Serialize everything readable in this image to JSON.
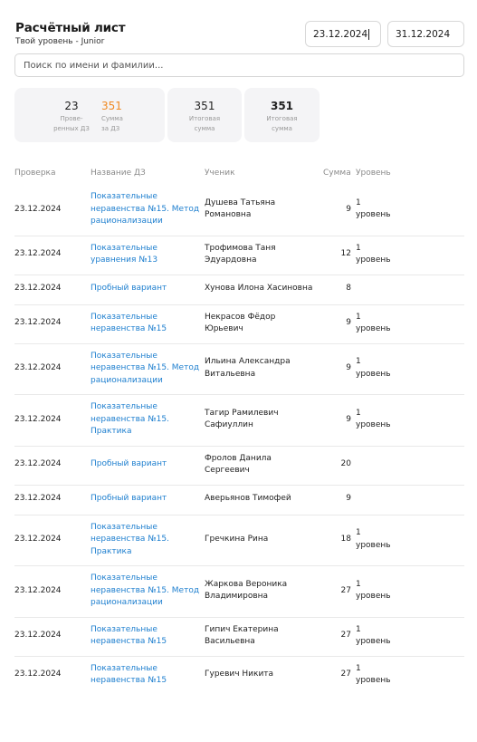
{
  "header": {
    "title": "Расчётный лист",
    "subtitle": "Твой уровень - Junior"
  },
  "dates": {
    "from": "23.12.2024",
    "to": "31.12.2024"
  },
  "search": {
    "placeholder": "Поиск по имени и фамилии..."
  },
  "stats": {
    "checked": {
      "value": "23",
      "label_1": "Прове-",
      "label_2": "ренных ДЗ"
    },
    "sum_hw": {
      "value": "351",
      "label_1": "Сумма",
      "label_2": "за ДЗ"
    },
    "total_1": {
      "value": "351",
      "label_1": "Итоговая",
      "label_2": "сумма"
    },
    "total_2": {
      "value": "351",
      "label_1": "Итоговая",
      "label_2": "сумма"
    }
  },
  "table": {
    "columns": [
      "Проверка",
      "Название ДЗ",
      "Ученик",
      "Сумма",
      "Уровень"
    ],
    "rows": [
      {
        "date": "23.12.2024",
        "hw": [
          "Показательные",
          "неравенства №15. Метод",
          "рационализации"
        ],
        "student": [
          "Душева Татьяна",
          "Романовна"
        ],
        "sum": "9",
        "level": [
          "1",
          "уровень"
        ]
      },
      {
        "date": "23.12.2024",
        "hw": [
          "Показательные",
          "уравнения №13"
        ],
        "student": [
          "Трофимова Таня",
          "Эдуардовна"
        ],
        "sum": "12",
        "level": [
          "1",
          "уровень"
        ]
      },
      {
        "date": "23.12.2024",
        "hw": [
          "Пробный вариант"
        ],
        "student": [
          "Хунова Илона Хасиновна"
        ],
        "sum": "8",
        "level": []
      },
      {
        "date": "23.12.2024",
        "hw": [
          "Показательные",
          "неравенства №15"
        ],
        "student": [
          "Некрасов Фёдор",
          "Юрьевич"
        ],
        "sum": "9",
        "level": [
          "1",
          "уровень"
        ]
      },
      {
        "date": "23.12.2024",
        "hw": [
          "Показательные",
          "неравенства №15. Метод",
          "рационализации"
        ],
        "student": [
          "Ильина Александра",
          "Витальевна"
        ],
        "sum": "9",
        "level": [
          "1",
          "уровень"
        ]
      },
      {
        "date": "23.12.2024",
        "hw": [
          "Показательные",
          "неравенства №15.",
          "Практика"
        ],
        "student": [
          "Тагир Рамилевич",
          "Сафиуллин"
        ],
        "sum": "9",
        "level": [
          "1",
          "уровень"
        ]
      },
      {
        "date": "23.12.2024",
        "hw": [
          "Пробный вариант"
        ],
        "student": [
          "Фролов Данила",
          "Сергеевич"
        ],
        "sum": "20",
        "level": []
      },
      {
        "date": "23.12.2024",
        "hw": [
          "Пробный вариант"
        ],
        "student": [
          "Аверьянов Тимофей"
        ],
        "sum": "9",
        "level": []
      },
      {
        "date": "23.12.2024",
        "hw": [
          "Показательные",
          "неравенства №15.",
          "Практика"
        ],
        "student": [
          "Гречкина Рина"
        ],
        "sum": "18",
        "level": [
          "1",
          "уровень"
        ]
      },
      {
        "date": "23.12.2024",
        "hw": [
          "Показательные",
          "неравенства №15. Метод",
          "рационализации"
        ],
        "student": [
          "Жаркова Вероника",
          "Владимировна"
        ],
        "sum": "27",
        "level": [
          "1",
          "уровень"
        ]
      },
      {
        "date": "23.12.2024",
        "hw": [
          "Показательные",
          "неравенства №15"
        ],
        "student": [
          "Гипич Екатерина",
          "Васильевна"
        ],
        "sum": "27",
        "level": [
          "1",
          "уровень"
        ]
      },
      {
        "date": "23.12.2024",
        "hw": [
          "Показательные",
          "неравенства №15"
        ],
        "student": [
          "Гуревич Никита"
        ],
        "sum": "27",
        "level": [
          "1",
          "уровень"
        ]
      }
    ]
  }
}
